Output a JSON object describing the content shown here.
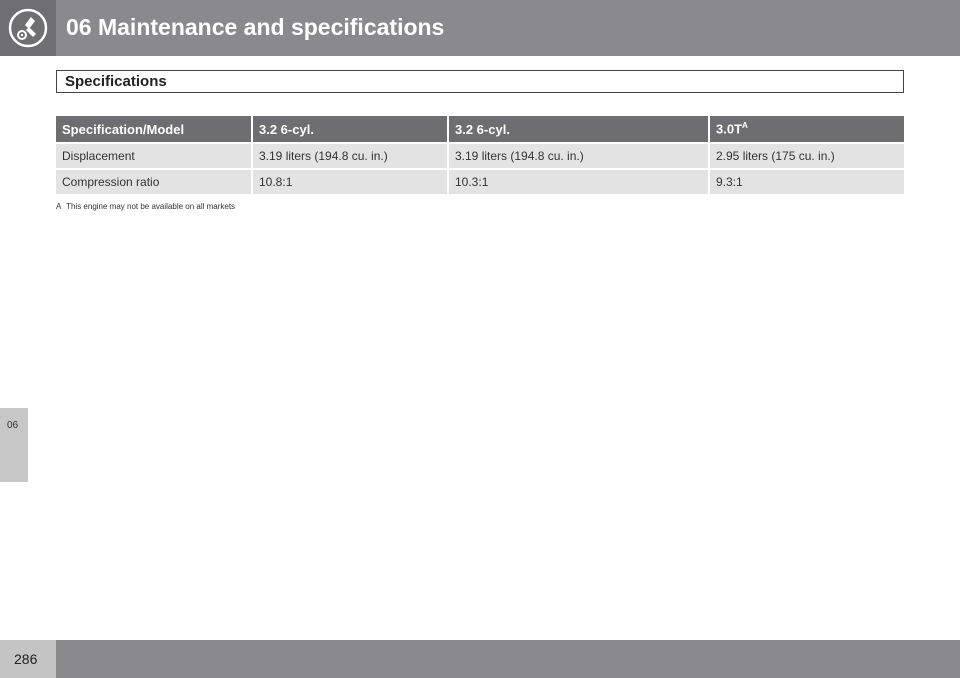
{
  "header": {
    "title": "06 Maintenance and specifications",
    "icon": "wrench-gear-icon"
  },
  "section": {
    "title": "Specifications"
  },
  "table": {
    "headers": [
      "Specification/Model",
      "3.2 6-cyl.",
      "3.2 6-cyl.",
      "3.0T"
    ],
    "header_superscript": "A",
    "rows": [
      [
        "Displacement",
        "3.19 liters (194.8 cu. in.)",
        "3.19 liters (194.8 cu. in.)",
        "2.95 liters (175 cu. in.)"
      ],
      [
        "Compression ratio",
        "10.8:1",
        "10.3:1",
        "9.3:1"
      ]
    ]
  },
  "footnote": {
    "mark": "A",
    "text": "This engine may not be available on all markets"
  },
  "side_tab": {
    "label": "06"
  },
  "footer": {
    "page_number": "286"
  },
  "colors": {
    "header_bg": "#8a8a8c",
    "table_header_bg": "#6e6e71",
    "table_cell_bg": "#e3e3e4"
  }
}
